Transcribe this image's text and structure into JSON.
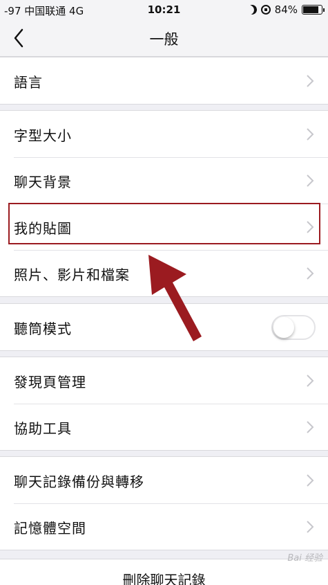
{
  "status_bar": {
    "carrier": "-97 中国联通  4G",
    "time": "10:21",
    "battery_percent": "84%",
    "battery_level": 0.84
  },
  "nav": {
    "title": "一般",
    "back_icon": "chevron-left-icon"
  },
  "groups": [
    {
      "items": [
        {
          "label": "語言"
        }
      ]
    },
    {
      "items": [
        {
          "label": "字型大小"
        },
        {
          "label": "聊天背景"
        },
        {
          "label": "我的貼圖",
          "highlighted": true
        },
        {
          "label": "照片、影片和檔案"
        }
      ]
    },
    {
      "items": [
        {
          "label": "聽筒模式",
          "toggle": false
        }
      ]
    },
    {
      "items": [
        {
          "label": "發現頁管理"
        },
        {
          "label": "協助工具"
        }
      ]
    },
    {
      "items": [
        {
          "label": "聊天記錄備份與轉移"
        },
        {
          "label": "記憶體空間"
        }
      ]
    }
  ],
  "delete_chat": "刪除聊天記錄",
  "annotation": {
    "highlight_color": "#9b1b20"
  },
  "colors": {
    "background": "#efeff4",
    "cell": "#ffffff",
    "chevron": "#c7c7cc"
  },
  "watermark": "Bai 经验"
}
